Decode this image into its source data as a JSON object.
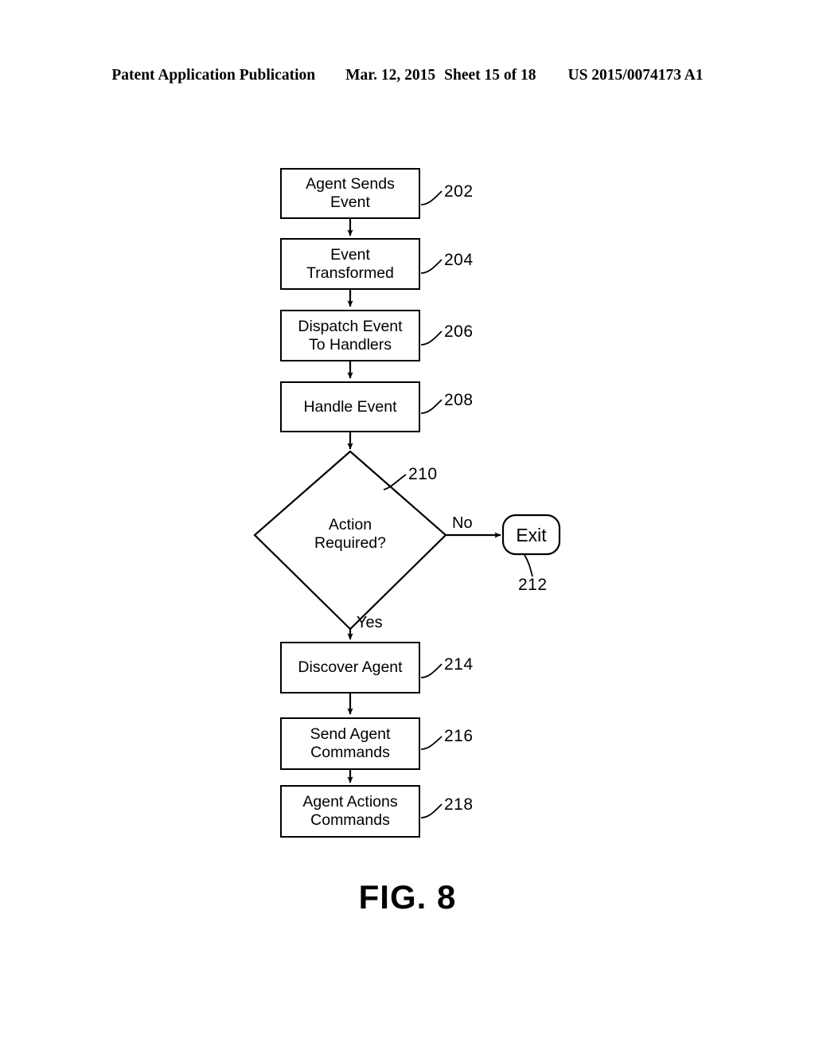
{
  "header": {
    "publication": "Patent Application Publication",
    "date": "Mar. 12, 2015",
    "sheet": "Sheet 15 of 18",
    "patent_number": "US 2015/0074173 A1"
  },
  "figure": {
    "caption": "FIG. 8",
    "type": "flowchart"
  },
  "flowchart": {
    "nodes": [
      {
        "ref": "202",
        "label": "Agent Sends Event",
        "lines": [
          "Agent Sends",
          "Event"
        ],
        "shape": "process"
      },
      {
        "ref": "204",
        "label": "Event Transformed",
        "lines": [
          "Event",
          "Transformed"
        ],
        "shape": "process"
      },
      {
        "ref": "206",
        "label": "Dispatch Event To Handlers",
        "lines": [
          "Dispatch Event",
          "To Handlers"
        ],
        "shape": "process"
      },
      {
        "ref": "208",
        "label": "Handle Event",
        "lines": [
          "Handle Event"
        ],
        "shape": "process"
      },
      {
        "ref": "210",
        "label": "Action Required?",
        "lines": [
          "Action",
          "Required?"
        ],
        "shape": "decision"
      },
      {
        "ref": "212",
        "label": "Exit",
        "lines": [
          "Exit"
        ],
        "shape": "terminator"
      },
      {
        "ref": "214",
        "label": "Discover Agent",
        "lines": [
          "Discover Agent"
        ],
        "shape": "process"
      },
      {
        "ref": "216",
        "label": "Send Agent Commands",
        "lines": [
          "Send Agent",
          "Commands"
        ],
        "shape": "process"
      },
      {
        "ref": "218",
        "label": "Agent Actions Commands",
        "lines": [
          "Agent Actions",
          "Commands"
        ],
        "shape": "process"
      }
    ],
    "branch_labels": {
      "no": "No",
      "yes": "Yes"
    },
    "edges": [
      {
        "from": "202",
        "to": "204",
        "label": ""
      },
      {
        "from": "204",
        "to": "206",
        "label": ""
      },
      {
        "from": "206",
        "to": "208",
        "label": ""
      },
      {
        "from": "208",
        "to": "210",
        "label": ""
      },
      {
        "from": "210",
        "to": "212",
        "label": "No"
      },
      {
        "from": "210",
        "to": "214",
        "label": "Yes"
      },
      {
        "from": "214",
        "to": "216",
        "label": ""
      },
      {
        "from": "216",
        "to": "218",
        "label": ""
      }
    ]
  },
  "style": {
    "line_color": "#000000",
    "background": "#ffffff"
  }
}
